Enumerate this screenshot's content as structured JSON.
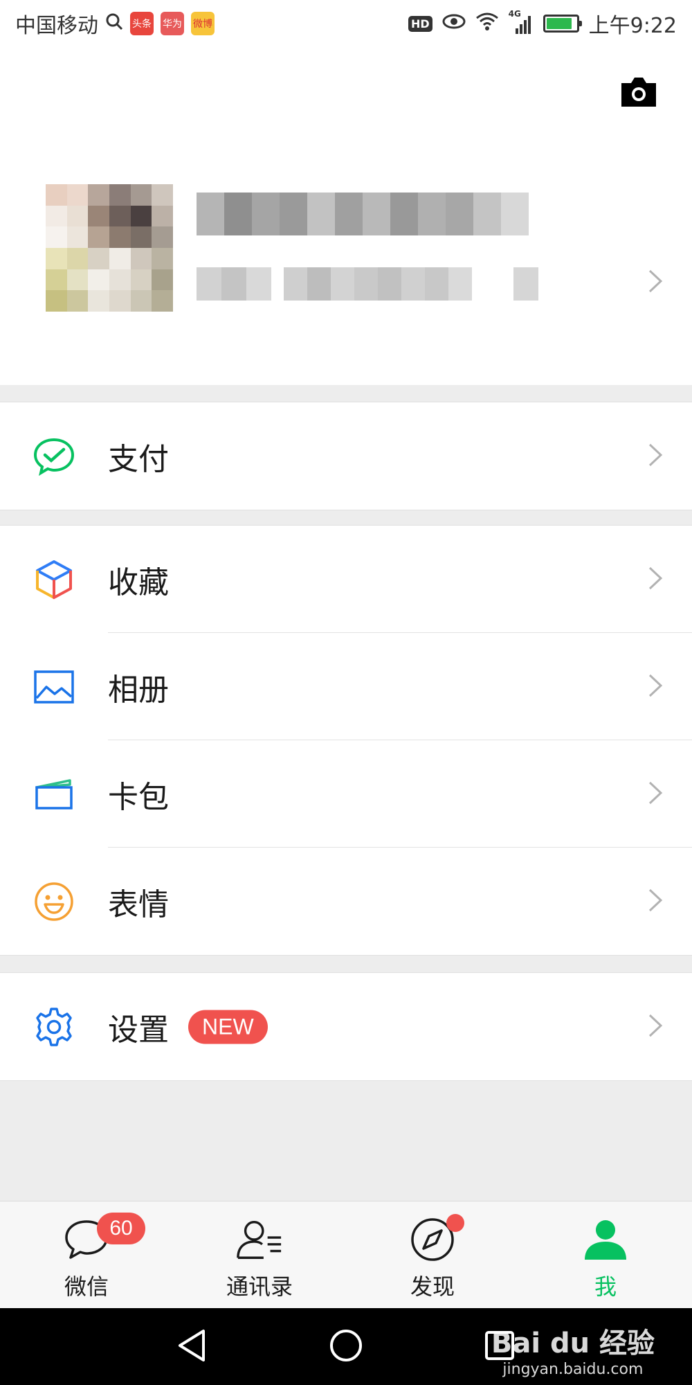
{
  "status_bar": {
    "carrier": "中国移动",
    "app_icons": [
      "头条",
      "华为",
      "微博"
    ],
    "hd": "HD",
    "network": "4G",
    "time": "上午9:22"
  },
  "profile": {
    "camera_icon": "camera-icon"
  },
  "menu": {
    "pay": {
      "label": "支付",
      "icon": "wechat-pay-icon"
    },
    "favorites": {
      "label": "收藏",
      "icon": "cube-icon"
    },
    "album": {
      "label": "相册",
      "icon": "image-icon"
    },
    "cards": {
      "label": "卡包",
      "icon": "card-wallet-icon"
    },
    "stickers": {
      "label": "表情",
      "icon": "smiley-icon"
    },
    "settings": {
      "label": "设置",
      "icon": "gear-icon",
      "badge": "NEW"
    }
  },
  "tabs": [
    {
      "label": "微信",
      "icon": "chat-icon",
      "badge": "60"
    },
    {
      "label": "通讯录",
      "icon": "contacts-icon"
    },
    {
      "label": "发现",
      "icon": "compass-icon",
      "dot": true
    },
    {
      "label": "我",
      "icon": "person-icon",
      "active": true
    }
  ],
  "watermark": {
    "main": "Bai du 经验",
    "sub": "jingyan.baidu.com"
  },
  "colors": {
    "accent_green": "#07c160",
    "badge_red": "#f0524e",
    "icon_blue": "#1a73e8",
    "icon_orange": "#f5a033"
  }
}
